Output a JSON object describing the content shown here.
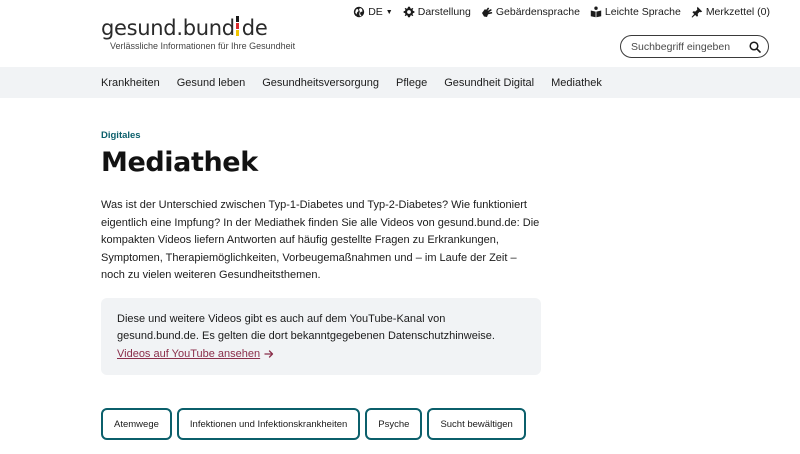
{
  "logo": {
    "wordmark_left": "gesund.bund",
    "wordmark_right": "de",
    "tagline": "Verlässliche Informationen für Ihre Gesundheit"
  },
  "utility": {
    "language": "DE",
    "display": "Darstellung",
    "sign_language": "Gebärdensprache",
    "easy_language": "Leichte Sprache",
    "bookmarks": "Merkzettel (0)"
  },
  "search": {
    "placeholder": "Suchbegriff eingeben"
  },
  "nav": {
    "items": [
      {
        "label": "Krankheiten"
      },
      {
        "label": "Gesund leben"
      },
      {
        "label": "Gesundheitsversorgung"
      },
      {
        "label": "Pflege"
      },
      {
        "label": "Gesundheit Digital"
      },
      {
        "label": "Mediathek"
      }
    ]
  },
  "main": {
    "kicker": "Digitales",
    "title": "Mediathek",
    "intro": "Was ist der Unterschied zwischen Typ-1-Diabetes und Typ-2-Diabetes? Wie funktioniert eigentlich eine Impfung? In der Mediathek finden Sie alle Videos von gesund.bund.de: Die kompakten Videos liefern Antworten auf häufig gestellte Fragen zu Erkrankungen, Symptomen, Therapiemöglichkeiten, Vorbeugemaßnahmen und – im Laufe der Zeit – noch zu vielen weiteren Gesundheitsthemen."
  },
  "notice": {
    "text": "Diese und weitere Videos gibt es auch auf dem YouTube-Kanal von gesund.bund.de. Es gelten die dort bekanntgegebenen Datenschutzhinweise.",
    "link": "Videos auf YouTube ansehen"
  },
  "chips": [
    {
      "label": "Atemwege"
    },
    {
      "label": "Infektionen und Infektionskrankheiten"
    },
    {
      "label": "Psyche"
    },
    {
      "label": "Sucht bewältigen"
    }
  ],
  "colors": {
    "accent": "#0b5f6b",
    "link": "#8a2e4a",
    "nav_bg": "#f1f3f5"
  }
}
